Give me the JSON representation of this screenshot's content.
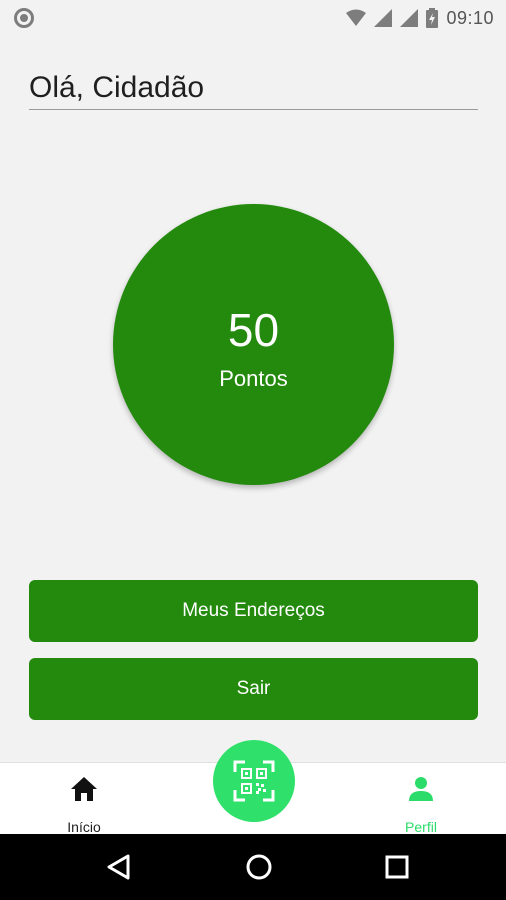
{
  "status_bar": {
    "time": "09:10"
  },
  "header": {
    "greeting": "Olá, Cidadão"
  },
  "points": {
    "value": "50",
    "label": "Pontos"
  },
  "actions": {
    "addresses_label": "Meus Endereços",
    "exit_label": "Sair"
  },
  "bottom_nav": {
    "home_label": "Início",
    "profile_label": "Perfil",
    "qr_icon": "qr-code-scan-icon"
  },
  "colors": {
    "primary_green": "#238a0d",
    "accent_green": "#2fe06b",
    "active_nav": "#2bdc6a",
    "background": "#f2f2f2"
  }
}
